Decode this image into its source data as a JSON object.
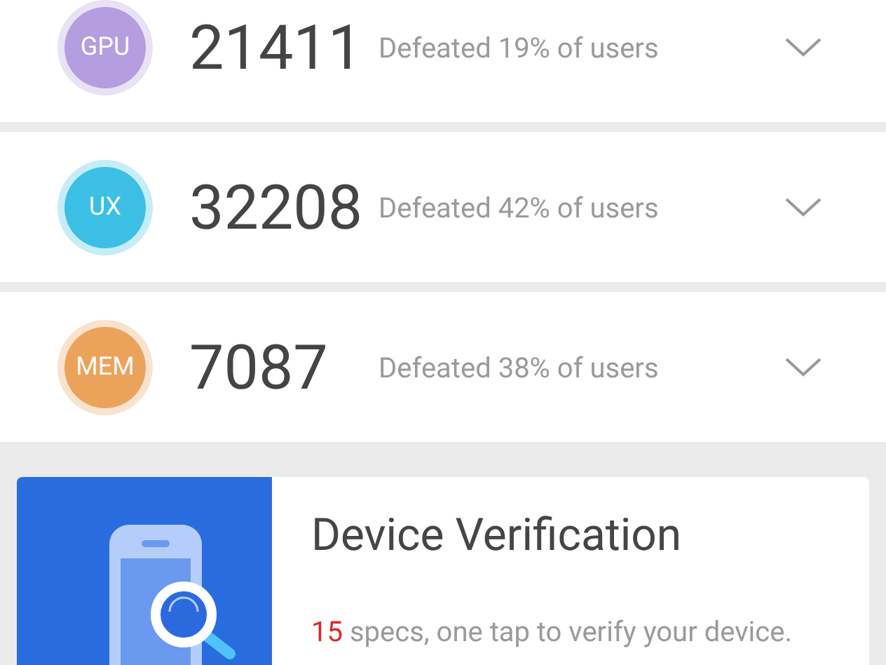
{
  "scores": [
    {
      "badge": "GPU",
      "color": "#b49edf",
      "score": "21411",
      "defeated": "Defeated 19% of users"
    },
    {
      "badge": "UX",
      "color": "#3cbfe4",
      "score": "32208",
      "defeated": "Defeated 42% of users"
    },
    {
      "badge": "MEM",
      "color": "#eba35c",
      "score": "7087",
      "defeated": "Defeated 38% of users"
    }
  ],
  "verification": {
    "title": "Device Verification",
    "spec_count": "15",
    "description": "specs, one tap to verify your device."
  }
}
